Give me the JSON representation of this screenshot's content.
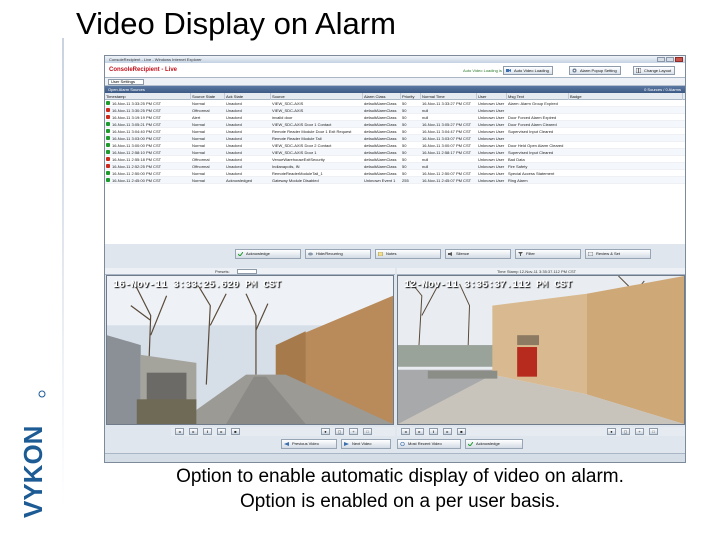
{
  "slide": {
    "title": "Video Display on Alarm",
    "caption_line1": "Option to enable automatic display of video on alarm.",
    "caption_line2": "Option is enabled on a per user basis.",
    "logo_text": "VYKON"
  },
  "window": {
    "title": "ConsoleRecipient - Live - Windows Internet Explorer",
    "app_title": "ConsoleRecipient - Live",
    "auto_video_label": "Auto Video Loading is ON",
    "toolbar_buttons": [
      "Auto Video Loading",
      "Alarm Popup Setting",
      "Change Layout"
    ],
    "filter_value": "User Settings"
  },
  "alarm_panel": {
    "header": "Open Alarm Sources",
    "header_right": "0 Sources / 0 Alarms",
    "columns": [
      "Timestamp",
      "Source State",
      "Ack State",
      "Source",
      "Alarm Class",
      "Priority",
      "Normal Time",
      "User",
      "Msg Text",
      "Badge"
    ],
    "rows": [
      [
        "16-Nov-11 3:33:25 PM CST",
        "Normal",
        "Unacked",
        "VIEW_SDC-AXIS",
        "defaultAlarmClass",
        "50",
        "16-Nov-11 3:33:27 PM CST",
        "Unknown User",
        "Alarm: Alarm Group Expired",
        ""
      ],
      [
        "16-Nov-11 3:30:25 PM CST",
        "Offnormal",
        "Unacked",
        "VIEW_SDC-AXIS",
        "defaultAlarmClass",
        "50",
        "null",
        "Unknown User",
        "",
        ""
      ],
      [
        "16-Nov-11 3:19:19 PM CST",
        "Alert",
        "Unacked",
        "invalid door",
        "defaultAlarmClass",
        "50",
        "null",
        "Unknown User",
        "Door Forced Alarm Expired",
        ""
      ],
      [
        "16-Nov-11 3:05:21 PM CST",
        "Normal",
        "Unacked",
        "VIEW_SDC-AXIS Door 1 Contact",
        "defaultAlarmClass",
        "50",
        "16-Nov-11 3:05:27 PM CST",
        "Unknown User",
        "Door Forced Alarm Cleared",
        ""
      ],
      [
        "16-Nov-11 3:04:40 PM CST",
        "Normal",
        "Unacked",
        "Remote Reader Module Door 1 Exit Request",
        "defaultAlarmClass",
        "50",
        "16-Nov-11 3:04:47 PM CST",
        "Unknown User",
        "Supervised Input Cleared",
        ""
      ],
      [
        "16-Nov-11 3:03:00 PM CST",
        "Normal",
        "Unacked",
        "Remote Reader Module Tail",
        "defaultAlarmClass",
        "50",
        "16-Nov-11 3:03:07 PM CST",
        "Unknown User",
        "",
        ""
      ],
      [
        "16-Nov-11 3:00:00 PM CST",
        "Normal",
        "Unacked",
        "VIEW_SDC-AXIS Door 2 Contact",
        "defaultAlarmClass",
        "50",
        "16-Nov-11 3:00:07 PM CST",
        "Unknown User",
        "Door Held Open Alarm Cleared",
        ""
      ],
      [
        "16-Nov-11 2:58:10 PM CST",
        "Normal",
        "Unacked",
        "VIEW_SDC-AXIS Door 1",
        "defaultAlarmClass",
        "50",
        "16-Nov-11 2:58:17 PM CST",
        "Unknown User",
        "Supervised Input Cleared",
        ""
      ],
      [
        "16-Nov-11 2:55:18 PM CST",
        "Offnormal",
        "Unacked",
        "VenueWarehouseExitSecurity",
        "defaultAlarmClass",
        "50",
        "null",
        "Unknown User",
        "Bad Data",
        ""
      ],
      [
        "16-Nov-11 2:52:25 PM CST",
        "Offnormal",
        "Unacked",
        "Indianapolis, IN",
        "defaultAlarmClass",
        "50",
        "null",
        "Unknown User",
        "Fire Safety",
        ""
      ],
      [
        "16-Nov-11 2:50:00 PM CST",
        "Normal",
        "Unacked",
        "RemoteReaderModuleTail_1",
        "defaultAlarmClass",
        "50",
        "16-Nov-11 2:50:07 PM CST",
        "Unknown User",
        "Special Access Statement",
        ""
      ],
      [
        "16-Nov-11 2:45:00 PM CST",
        "Normal",
        "Acknowledged",
        "Gateway Module Disabled",
        "Unknown Event 1",
        "255",
        "16-Nov-11 2:45:07 PM CST",
        "Unknown User",
        "Ring Alarm",
        ""
      ]
    ],
    "buttons": [
      "Acknowledge",
      "Hide/Recurring",
      "Notes",
      "Silence",
      "Filter",
      "Review & Set"
    ]
  },
  "video": {
    "left_timestamp": "16-Nov-11 3:33:25.620 PM CST",
    "right_timestamp": "12-Nov-11 3:35:37.112 PM CST",
    "left_bar_label": "Presets:",
    "right_bar_label": "Time Stamp 12-Nov-11 3:35:37.112 PM CST",
    "bottom_buttons": [
      "Previous Video",
      "Next Video",
      "Most Recent Video",
      "Acknowledge"
    ]
  },
  "colors": {
    "app_title_red": "#c0101a",
    "panel_header": "#3d5a85",
    "status_green": "#1f9a2c",
    "status_red": "#cc2a1d",
    "logo_blue": "#1d5b95"
  }
}
